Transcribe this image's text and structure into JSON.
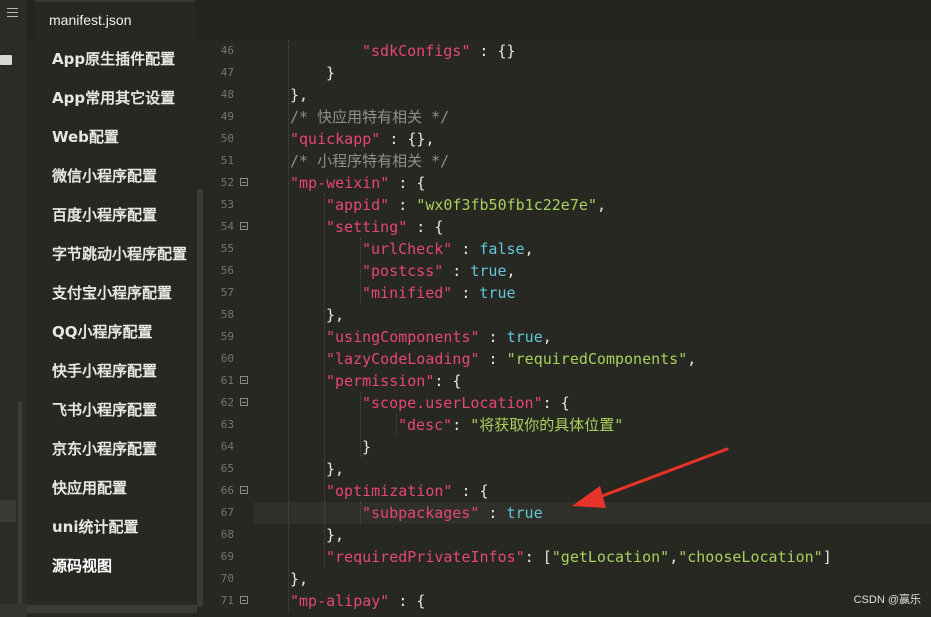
{
  "tabs": [
    {
      "label": "manifest.json"
    }
  ],
  "sidebar": {
    "items": [
      {
        "label": "App原生插件配置"
      },
      {
        "label": "App常用其它设置"
      },
      {
        "label": "Web配置"
      },
      {
        "label": "微信小程序配置"
      },
      {
        "label": "百度小程序配置"
      },
      {
        "label": "字节跳动小程序配置"
      },
      {
        "label": "支付宝小程序配置"
      },
      {
        "label": "QQ小程序配置"
      },
      {
        "label": "快手小程序配置"
      },
      {
        "label": "飞书小程序配置"
      },
      {
        "label": "京东小程序配置"
      },
      {
        "label": "快应用配置"
      },
      {
        "label": "uni统计配置"
      },
      {
        "label": "源码视图"
      }
    ]
  },
  "editor": {
    "lines": [
      {
        "num": "46",
        "indent": 3,
        "fold": false,
        "tokens": [
          {
            "t": "s",
            "v": "\"sdkConfigs\""
          },
          {
            "t": "p",
            "v": " : {}"
          }
        ]
      },
      {
        "num": "47",
        "indent": 2,
        "fold": false,
        "tokens": [
          {
            "t": "p",
            "v": "}"
          }
        ]
      },
      {
        "num": "48",
        "indent": 1,
        "fold": false,
        "tokens": [
          {
            "t": "p",
            "v": "},"
          }
        ]
      },
      {
        "num": "49",
        "indent": 1,
        "fold": false,
        "tokens": [
          {
            "t": "c",
            "v": "/* 快应用特有相关 */"
          }
        ]
      },
      {
        "num": "50",
        "indent": 1,
        "fold": false,
        "tokens": [
          {
            "t": "s",
            "v": "\"quickapp\""
          },
          {
            "t": "p",
            "v": " : {},"
          }
        ]
      },
      {
        "num": "51",
        "indent": 1,
        "fold": false,
        "tokens": [
          {
            "t": "c",
            "v": "/* 小程序特有相关 */"
          }
        ]
      },
      {
        "num": "52",
        "indent": 1,
        "fold": true,
        "tokens": [
          {
            "t": "s",
            "v": "\"mp-weixin\""
          },
          {
            "t": "p",
            "v": " : {"
          }
        ]
      },
      {
        "num": "53",
        "indent": 2,
        "fold": false,
        "tokens": [
          {
            "t": "s",
            "v": "\"appid\""
          },
          {
            "t": "p",
            "v": " : "
          },
          {
            "t": "v",
            "v": "\"wx0f3fb50fb1c22e7e\""
          },
          {
            "t": "p",
            "v": ","
          }
        ]
      },
      {
        "num": "54",
        "indent": 2,
        "fold": true,
        "tokens": [
          {
            "t": "s",
            "v": "\"setting\""
          },
          {
            "t": "p",
            "v": " : {"
          }
        ]
      },
      {
        "num": "55",
        "indent": 3,
        "fold": false,
        "tokens": [
          {
            "t": "s",
            "v": "\"urlCheck\""
          },
          {
            "t": "p",
            "v": " : "
          },
          {
            "t": "b",
            "v": "false"
          },
          {
            "t": "p",
            "v": ","
          }
        ]
      },
      {
        "num": "56",
        "indent": 3,
        "fold": false,
        "tokens": [
          {
            "t": "s",
            "v": "\"postcss\""
          },
          {
            "t": "p",
            "v": " : "
          },
          {
            "t": "b",
            "v": "true"
          },
          {
            "t": "p",
            "v": ","
          }
        ]
      },
      {
        "num": "57",
        "indent": 3,
        "fold": false,
        "tokens": [
          {
            "t": "s",
            "v": "\"minified\""
          },
          {
            "t": "p",
            "v": " : "
          },
          {
            "t": "b",
            "v": "true"
          }
        ]
      },
      {
        "num": "58",
        "indent": 2,
        "fold": false,
        "tokens": [
          {
            "t": "p",
            "v": "},"
          }
        ]
      },
      {
        "num": "59",
        "indent": 2,
        "fold": false,
        "tokens": [
          {
            "t": "s",
            "v": "\"usingComponents\""
          },
          {
            "t": "p",
            "v": " : "
          },
          {
            "t": "b",
            "v": "true"
          },
          {
            "t": "p",
            "v": ","
          }
        ]
      },
      {
        "num": "60",
        "indent": 2,
        "fold": false,
        "tokens": [
          {
            "t": "s",
            "v": "\"lazyCodeLoading\""
          },
          {
            "t": "p",
            "v": " : "
          },
          {
            "t": "v",
            "v": "\"requiredComponents\""
          },
          {
            "t": "p",
            "v": ","
          }
        ]
      },
      {
        "num": "61",
        "indent": 2,
        "fold": true,
        "tokens": [
          {
            "t": "s",
            "v": "\"permission\""
          },
          {
            "t": "p",
            "v": ": {"
          }
        ]
      },
      {
        "num": "62",
        "indent": 3,
        "fold": true,
        "tokens": [
          {
            "t": "s",
            "v": "\"scope.userLocation\""
          },
          {
            "t": "p",
            "v": ": {"
          }
        ]
      },
      {
        "num": "63",
        "indent": 4,
        "fold": false,
        "tokens": [
          {
            "t": "s",
            "v": "\"desc\""
          },
          {
            "t": "p",
            "v": ": "
          },
          {
            "t": "v",
            "v": "\"将获取你的具体位置\""
          }
        ]
      },
      {
        "num": "64",
        "indent": 3,
        "fold": false,
        "tokens": [
          {
            "t": "p",
            "v": "}"
          }
        ]
      },
      {
        "num": "65",
        "indent": 2,
        "fold": false,
        "tokens": [
          {
            "t": "p",
            "v": "},"
          }
        ]
      },
      {
        "num": "66",
        "indent": 2,
        "fold": true,
        "tokens": [
          {
            "t": "s",
            "v": "\"optimization\""
          },
          {
            "t": "p",
            "v": " : {"
          }
        ]
      },
      {
        "num": "67",
        "indent": 3,
        "fold": false,
        "highlight": true,
        "tokens": [
          {
            "t": "s",
            "v": "\"subpackages\""
          },
          {
            "t": "p",
            "v": " : "
          },
          {
            "t": "b",
            "v": "true"
          }
        ]
      },
      {
        "num": "68",
        "indent": 2,
        "fold": false,
        "tokens": [
          {
            "t": "p",
            "v": "},"
          }
        ]
      },
      {
        "num": "69",
        "indent": 2,
        "fold": false,
        "tokens": [
          {
            "t": "s",
            "v": "\"requiredPrivateInfos\""
          },
          {
            "t": "p",
            "v": ": ["
          },
          {
            "t": "v",
            "v": "\"getLocation\""
          },
          {
            "t": "p",
            "v": ","
          },
          {
            "t": "v",
            "v": "\"chooseLocation\""
          },
          {
            "t": "p",
            "v": "]"
          }
        ]
      },
      {
        "num": "70",
        "indent": 1,
        "fold": false,
        "tokens": [
          {
            "t": "p",
            "v": "},"
          }
        ]
      },
      {
        "num": "71",
        "indent": 1,
        "fold": true,
        "tokens": [
          {
            "t": "s",
            "v": "\"mp-alipay\""
          },
          {
            "t": "p",
            "v": " : {"
          }
        ]
      }
    ]
  },
  "annotation": {
    "color": "#e8332b"
  },
  "watermark": "CSDN @赢乐"
}
